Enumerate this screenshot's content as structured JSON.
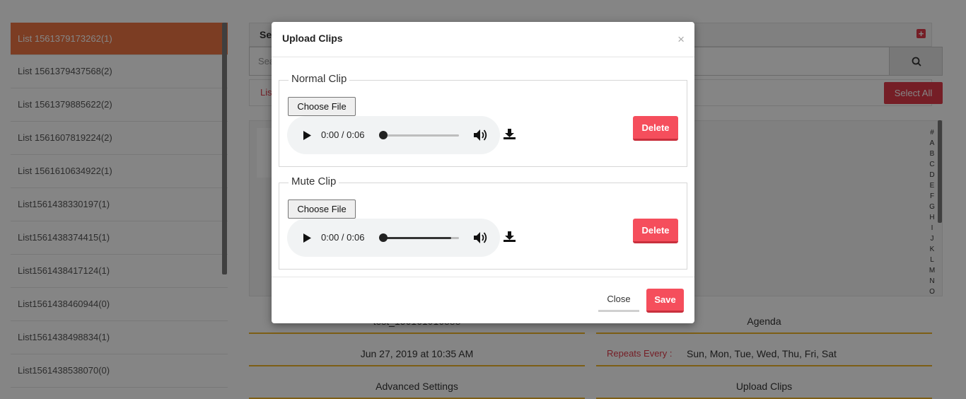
{
  "sidebar": {
    "items": [
      {
        "label": "List 1561379173262(1)"
      },
      {
        "label": "List 1561379437568(2)"
      },
      {
        "label": "List 1561379885622(2)"
      },
      {
        "label": "List 1561607819224(2)"
      },
      {
        "label": "List 1561610634922(1)"
      },
      {
        "label": "List1561438330197(1)"
      },
      {
        "label": "List1561438374415(1)"
      },
      {
        "label": "List1561438417124(1)"
      },
      {
        "label": "List1561438460944(0)"
      },
      {
        "label": "List1561438498834(1)"
      },
      {
        "label": "List1561438538070(0)"
      }
    ]
  },
  "search_panel": {
    "title": "Se",
    "placeholder": "Sea",
    "tab_label": "Lis"
  },
  "select_all_label": "Select All",
  "alphabet": [
    "#",
    "A",
    "B",
    "C",
    "D",
    "E",
    "F",
    "G",
    "H",
    "I",
    "J",
    "K",
    "L",
    "M",
    "N",
    "O"
  ],
  "fields": {
    "name_value": "test_156161016888",
    "agenda_label": "Agenda",
    "datetime_value": "Jun 27, 2019 at 10:35 AM",
    "repeats_label": "Repeats Every :",
    "repeats_value": "Sun, Mon, Tue, Wed, Thu, Fri, Sat",
    "advanced_label": "Advanced Settings",
    "upload_clips_label": "Upload Clips"
  },
  "modal": {
    "title": "Upload Clips",
    "close_symbol": "×",
    "sections": [
      {
        "legend": "Normal Clip",
        "file_button": "Choose File",
        "time": "0:00 / 0:06",
        "progress": 0.0,
        "buffered": 0.0,
        "delete_label": "Delete"
      },
      {
        "legend": "Mute Clip",
        "file_button": "Choose File",
        "time": "0:00 / 0:06",
        "progress": 0.0,
        "buffered": 0.9,
        "delete_label": "Delete"
      }
    ],
    "close_label": "Close",
    "save_label": "Save"
  },
  "colors": {
    "accent": "#f54e5c",
    "active_item": "#ee7644",
    "field_underline": "#f0b429"
  }
}
